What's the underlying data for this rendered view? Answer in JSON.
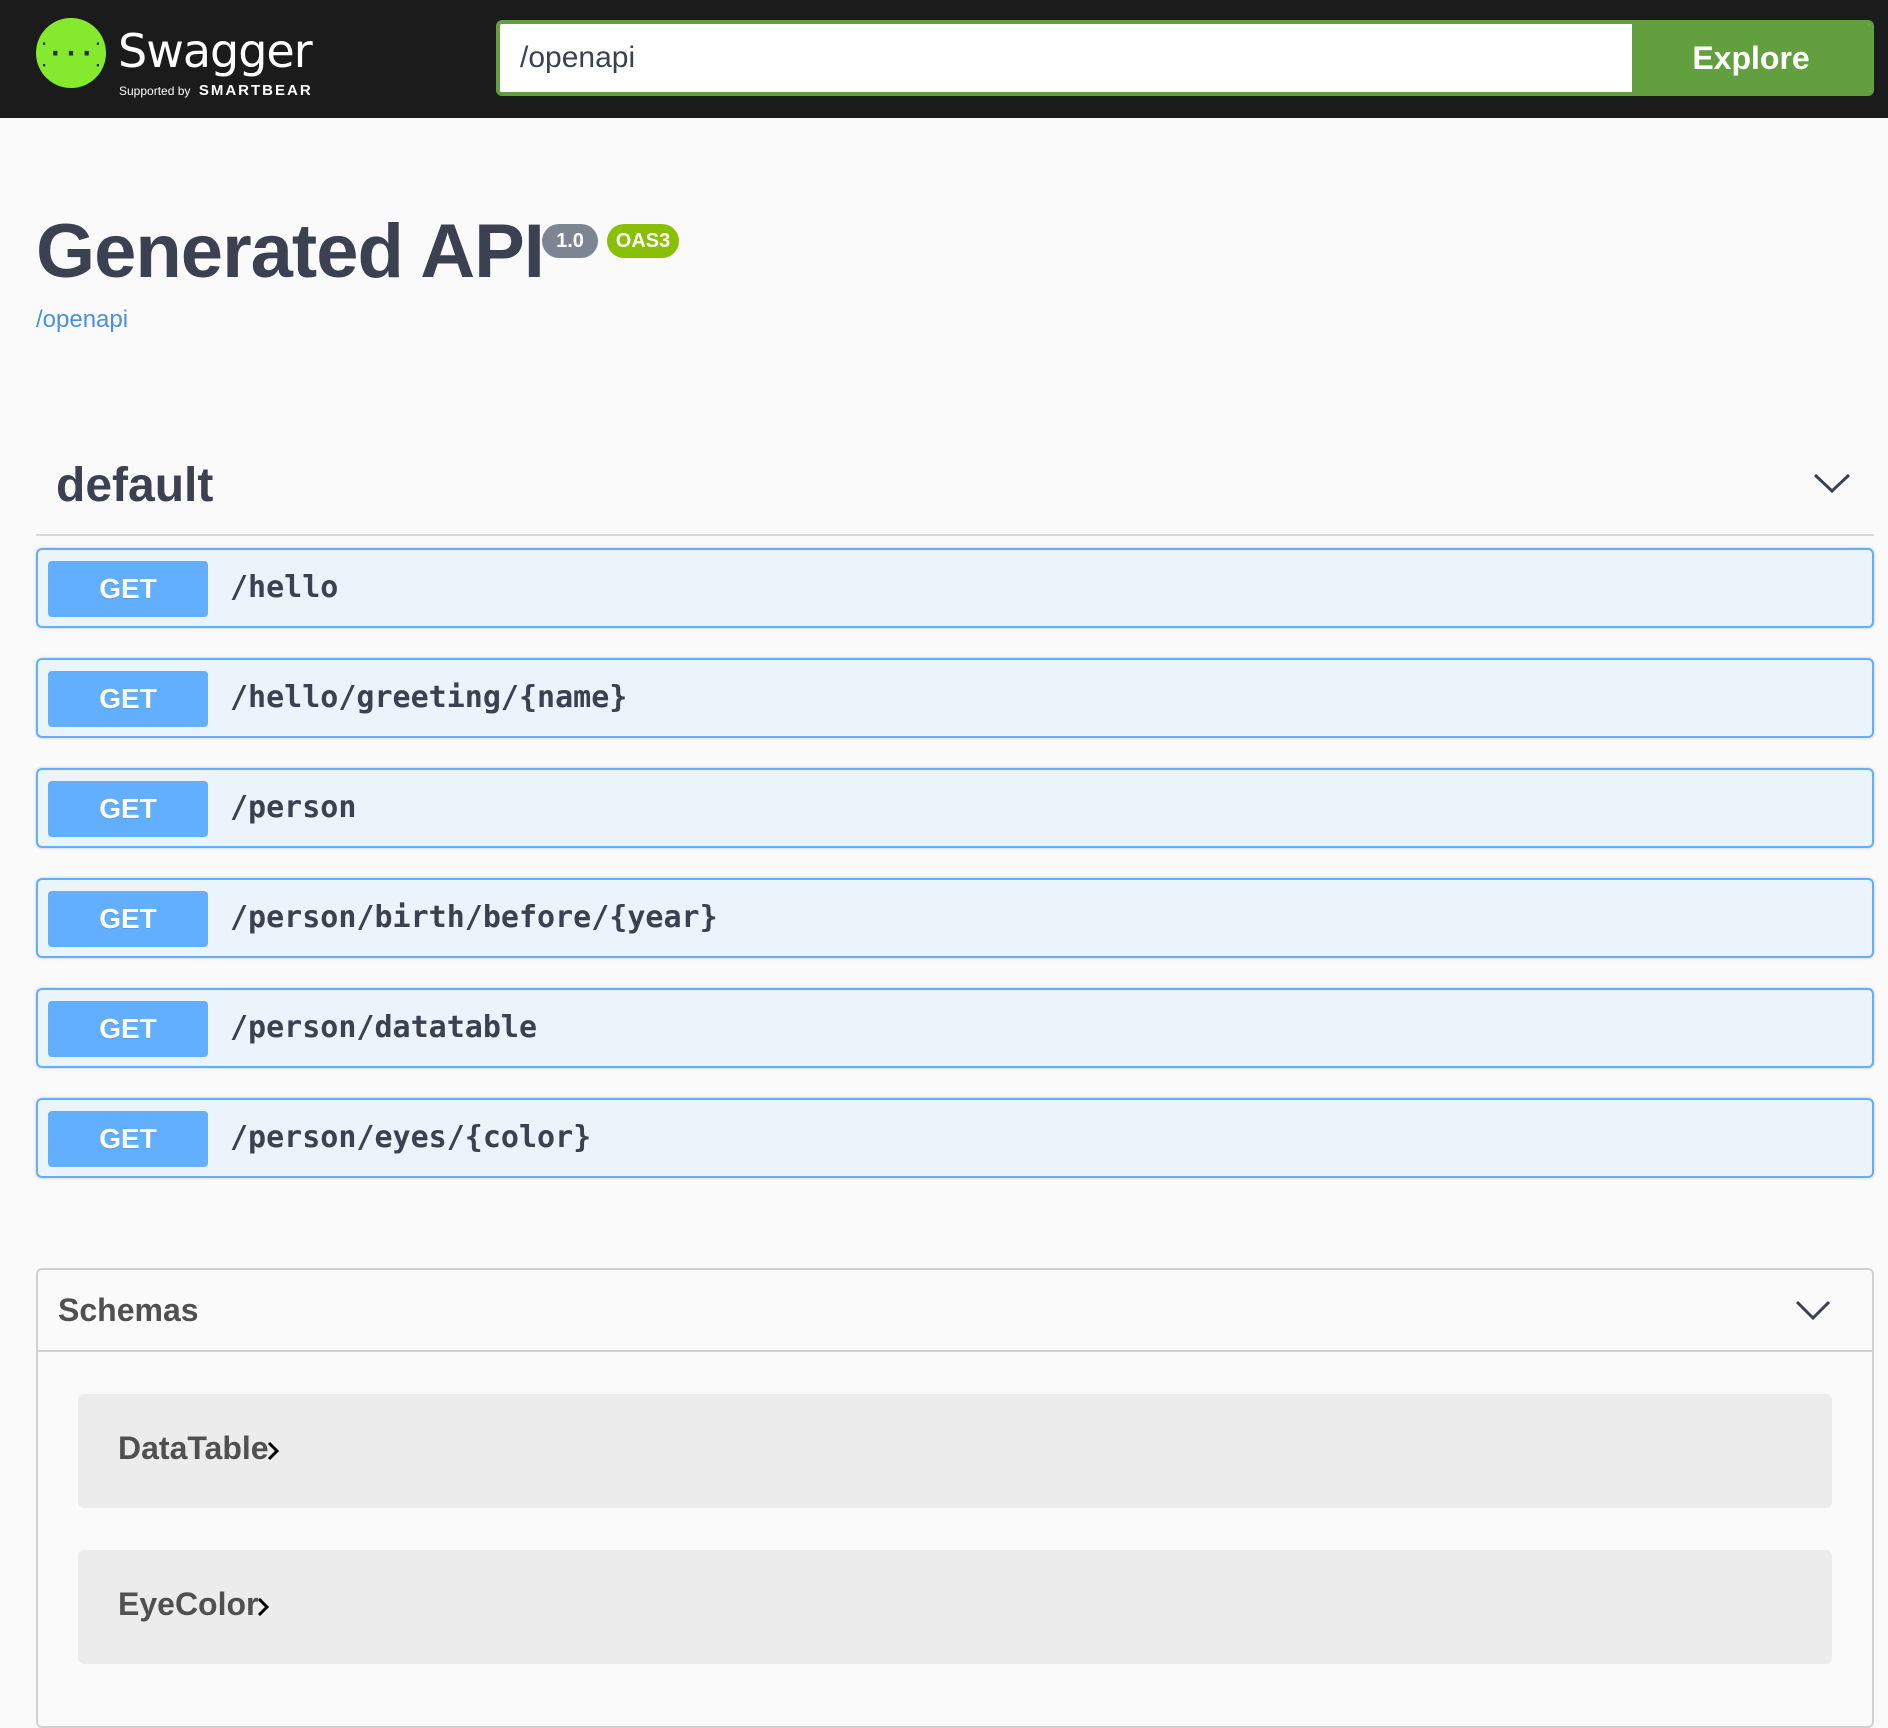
{
  "header": {
    "brand": "Swagger",
    "supported_by": "Supported by",
    "company": "SMARTBEAR",
    "url_value": "/openapi",
    "explore_label": "Explore"
  },
  "info": {
    "title": "Generated API",
    "version": "1.0",
    "oas_badge": "OAS3",
    "spec_url": "/openapi"
  },
  "tag": {
    "name": "default",
    "operations": [
      {
        "method": "GET",
        "path": "/hello"
      },
      {
        "method": "GET",
        "path": "/hello/greeting/{name}"
      },
      {
        "method": "GET",
        "path": "/person"
      },
      {
        "method": "GET",
        "path": "/person/birth/before/{year}"
      },
      {
        "method": "GET",
        "path": "/person/datatable"
      },
      {
        "method": "GET",
        "path": "/person/eyes/{color}"
      }
    ]
  },
  "schemas": {
    "title": "Schemas",
    "models": [
      "DataTable",
      "EyeColor"
    ]
  },
  "colors": {
    "get_method": "#61affe",
    "get_bg": "#ebf3fb",
    "accent_green": "#62a03f",
    "logo_green": "#85ea2d",
    "oas_badge": "#89bf04",
    "version_badge": "#7d8492"
  },
  "icons": {
    "logo": "swagger-braces-icon",
    "tag_toggle": "chevron-down-icon",
    "schemas_toggle": "chevron-down-icon",
    "model_expand": "chevron-right-icon"
  }
}
